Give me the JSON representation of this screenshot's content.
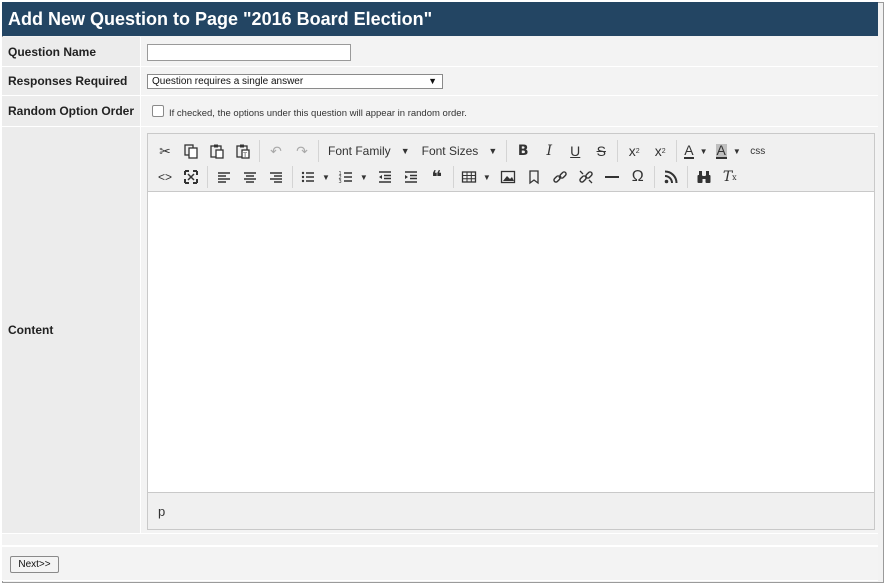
{
  "header": {
    "title": "Add New Question to Page \"2016 Board Election\""
  },
  "form": {
    "question_name": {
      "label": "Question Name",
      "value": ""
    },
    "responses_required": {
      "label": "Responses Required",
      "selected": "Question requires a single answer"
    },
    "random_option_order": {
      "label": "Random Option Order",
      "checked": false,
      "hint": "If checked, the options under this question will appear in random order."
    },
    "content": {
      "label": "Content"
    }
  },
  "editor": {
    "font_family_label": "Font Family",
    "font_sizes_label": "Font Sizes",
    "bold_label": "B",
    "italic_label": "I",
    "underline_label": "U",
    "strike_label": "S",
    "css_label": "css",
    "status_path": "p"
  },
  "footer": {
    "next_label": "Next>>"
  }
}
